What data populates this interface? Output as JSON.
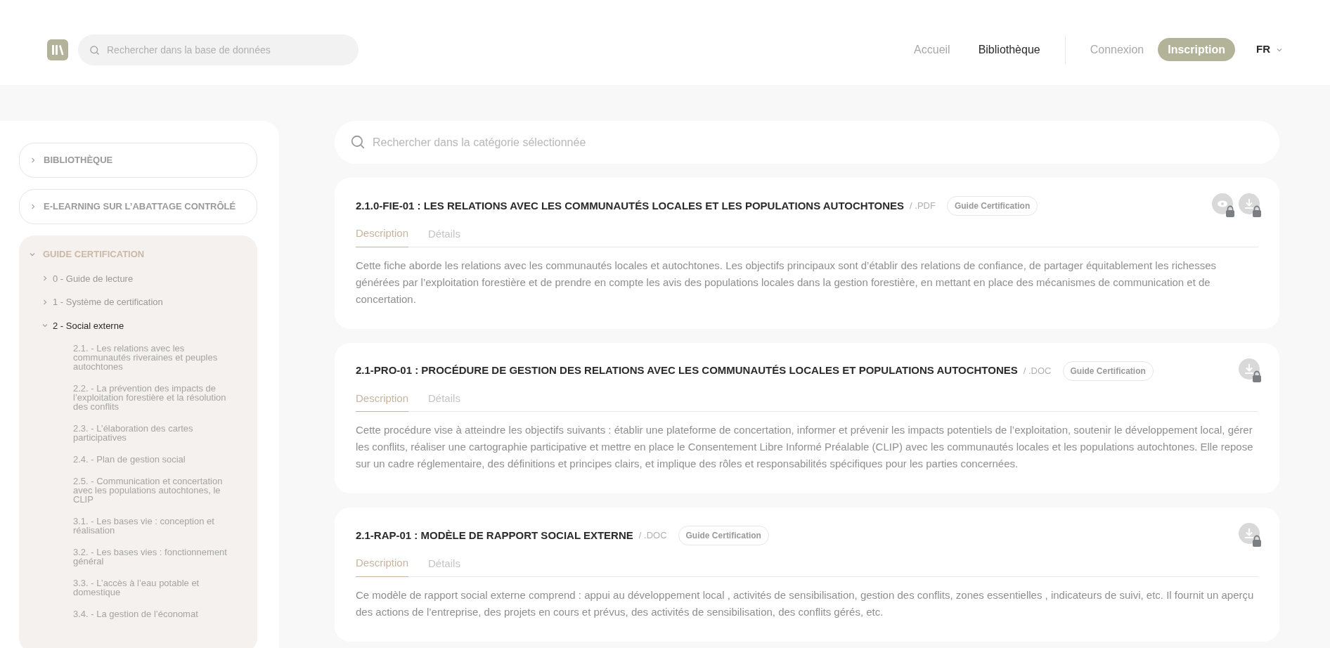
{
  "header": {
    "search": {
      "placeholder": "Rechercher dans la base de données"
    },
    "nav": [
      {
        "label": "Accueil",
        "selected": false
      },
      {
        "label": "Bibliothèque",
        "selected": true
      }
    ],
    "login": "Connexion",
    "signup": "Inscription",
    "language": "FR"
  },
  "sidebar": {
    "items": [
      {
        "label": "BIBLIOTHÈQUE",
        "expanded": false
      },
      {
        "label": "E-LEARNING SUR L’ABATTAGE CONTRÔLÉ",
        "expanded": false
      },
      {
        "label": "GUIDE CERTIFICATION",
        "expanded": true,
        "children": [
          {
            "label": "0 - Guide de lecture",
            "expanded": false,
            "selected": false
          },
          {
            "label": "1 - Système de certification",
            "expanded": false,
            "selected": false
          },
          {
            "label": "2 - Social externe",
            "expanded": true,
            "selected": true,
            "children": [
              {
                "label": "2.1. - Les relations avec les communautés riveraines et peuples autochtones"
              },
              {
                "label": "2.2. - La prévention des impacts de l’exploitation forestière et la résolution des conflits"
              },
              {
                "label": "2.3. - L’élaboration des cartes participatives"
              },
              {
                "label": "2.4. - Plan de gestion social"
              },
              {
                "label": "2.5. - Communication et concertation avec les populations autochtones, le CLIP"
              },
              {
                "label": "3.1. - Les bases vie : conception et réalisation"
              },
              {
                "label": "3.2. - Les bases vies : fonctionnement général"
              },
              {
                "label": "3.3. - L’accès à l’eau potable et domestique"
              },
              {
                "label": "3.4. - La gestion de l’économat"
              }
            ]
          }
        ]
      }
    ]
  },
  "content": {
    "search": {
      "placeholder": "Rechercher dans la catégorie sélectionnée"
    },
    "documents": [
      {
        "title": "2.1.0-FIE-01 : LES RELATIONS AVEC LES COMMUNAUTÉS LOCALES ET LES POPULATIONS AUTOCHTONES",
        "format": "/ .PDF",
        "tag": "Guide Certification",
        "actions": [
          {
            "kind": "view",
            "locked": true
          },
          {
            "kind": "download",
            "locked": true
          }
        ],
        "tabs": [
          {
            "label": "Description",
            "selected": true
          },
          {
            "label": "Détails",
            "selected": false
          }
        ],
        "description": "Cette fiche aborde les relations avec les communautés locales et autochtones. Les objectifs principaux sont d’établir des relations de confiance, de partager équitablement les richesses générées par l’exploitation forestière et de prendre en compte les avis des populations locales dans la gestion forestière, en mettant en place des mécanismes de communication et de concertation."
      },
      {
        "title": "2.1-PRO-01 : PROCÉDURE DE GESTION DES RELATIONS AVEC LES COMMUNAUTÉS LOCALES ET POPULATIONS AUTOCHTONES",
        "format": "/ .DOC",
        "tag": "Guide Certification",
        "actions": [
          {
            "kind": "download",
            "locked": true
          }
        ],
        "tabs": [
          {
            "label": "Description",
            "selected": true
          },
          {
            "label": "Détails",
            "selected": false
          }
        ],
        "description": "Cette procédure vise à atteindre les objectifs suivants : établir une plateforme de concertation, informer et prévenir les impacts potentiels de l’exploitation, soutenir le développement local, gérer les conflits, réaliser une cartographie participative et mettre en place le Consentement Libre Informé Préalable (CLIP) avec les communautés locales et les populations autochtones. Elle repose sur un cadre réglementaire, des définitions et principes clairs, et implique des rôles et responsabilités spécifiques pour les parties concernées."
      },
      {
        "title": "2.1-RAP-01 : MODÈLE DE RAPPORT SOCIAL EXTERNE",
        "format": "/ .DOC",
        "tag": "Guide Certification",
        "actions": [
          {
            "kind": "download",
            "locked": true
          }
        ],
        "tabs": [
          {
            "label": "Description",
            "selected": true
          },
          {
            "label": "Détails",
            "selected": false
          }
        ],
        "description": "Ce modèle de rapport social externe comprend : appui au développement local , activités de sensibilisation, gestion des conflits, zones essentielles , indicateurs de suivi, etc. Il fournit un aperçu des actions de l’entreprise, des projets en cours et prévus, des activités de sensibilisation, des conflits gérés, etc."
      }
    ]
  }
}
